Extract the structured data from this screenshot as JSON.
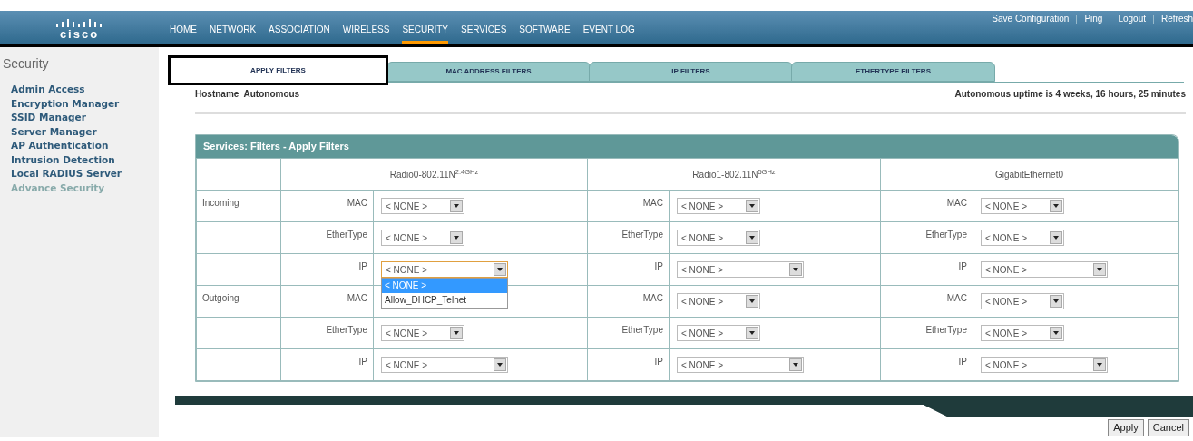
{
  "brand": "cisco",
  "top_links": [
    "Save Configuration",
    "Ping",
    "Logout",
    "Refresh"
  ],
  "nav": [
    {
      "label": "HOME",
      "selected": false
    },
    {
      "label": "NETWORK",
      "selected": false
    },
    {
      "label": "ASSOCIATION",
      "selected": false
    },
    {
      "label": "WIRELESS",
      "selected": false
    },
    {
      "label": "SECURITY",
      "selected": true
    },
    {
      "label": "SERVICES",
      "selected": false
    },
    {
      "label": "SOFTWARE",
      "selected": false
    },
    {
      "label": "EVENT LOG",
      "selected": false
    }
  ],
  "sidebar": {
    "title": "Security",
    "items": [
      {
        "label": "Admin Access",
        "disabled": false
      },
      {
        "label": "Encryption Manager",
        "disabled": false
      },
      {
        "label": "SSID Manager",
        "disabled": false
      },
      {
        "label": "Server Manager",
        "disabled": false
      },
      {
        "label": "AP Authentication",
        "disabled": false
      },
      {
        "label": "Intrusion Detection",
        "disabled": false
      },
      {
        "label": "Local RADIUS Server",
        "disabled": false
      },
      {
        "label": "Advance Security",
        "disabled": true
      }
    ]
  },
  "tabs": [
    {
      "label": "APPLY FILTERS",
      "selected": true
    },
    {
      "label": "MAC ADDRESS FILTERS",
      "selected": false
    },
    {
      "label": "IP FILTERS",
      "selected": false
    },
    {
      "label": "ETHERTYPE FILTERS",
      "selected": false
    }
  ],
  "hostname": "Hostname  Autonomous",
  "uptime": "Autonomous uptime is 4 weeks, 16 hours, 25 minutes",
  "panel": {
    "title": "Services: Filters - Apply Filters",
    "interfaces": [
      "Radio0-802.11N$^{2.4GHz}$",
      "Radio1-802.11N$^{5GHz}$",
      "GigabitEthernet0"
    ],
    "rows": [
      {
        "direction": "Incoming",
        "cells": [
          {
            "label": "MAC",
            "value": "< NONE >",
            "kind": "short"
          },
          {
            "label": "MAC",
            "value": "< NONE >",
            "kind": "short"
          },
          {
            "label": "MAC",
            "value": "< NONE >",
            "kind": "short"
          }
        ]
      },
      {
        "cells": [
          {
            "label": "EtherType",
            "value": "< NONE >",
            "kind": "short"
          },
          {
            "label": "EtherType",
            "value": "< NONE >",
            "kind": "short"
          },
          {
            "label": "EtherType",
            "value": "< NONE >",
            "kind": "short"
          }
        ]
      },
      {
        "cells": [
          {
            "label": "IP",
            "value": "< NONE >",
            "kind": "wide",
            "expanded": true,
            "options": [
              {
                "label": "< NONE >",
                "selected": true
              },
              {
                "label": "Allow_DHCP_Telnet",
                "selected": false
              }
            ]
          },
          {
            "label": "IP",
            "value": "< NONE >",
            "kind": "wide"
          },
          {
            "label": "IP",
            "value": "< NONE >",
            "kind": "wide"
          }
        ]
      },
      {
        "direction": "Outgoing",
        "cells": [
          {
            "label": "MAC",
            "kind": "short"
          },
          {
            "label": "MAC",
            "value": "< NONE >",
            "kind": "short"
          },
          {
            "label": "MAC",
            "value": "< NONE >",
            "kind": "short"
          }
        ]
      },
      {
        "cells": [
          {
            "label": "EtherType",
            "value": "< NONE >",
            "kind": "short"
          },
          {
            "label": "EtherType",
            "value": "< NONE >",
            "kind": "short"
          },
          {
            "label": "EtherType",
            "value": "< NONE >",
            "kind": "short"
          }
        ]
      },
      {
        "cells": [
          {
            "label": "IP",
            "value": "< NONE >",
            "kind": "wide"
          },
          {
            "label": "IP",
            "value": "< NONE >",
            "kind": "wide"
          },
          {
            "label": "IP",
            "value": "< NONE >",
            "kind": "wide"
          }
        ]
      }
    ]
  },
  "buttons": [
    "Apply",
    "Cancel"
  ]
}
